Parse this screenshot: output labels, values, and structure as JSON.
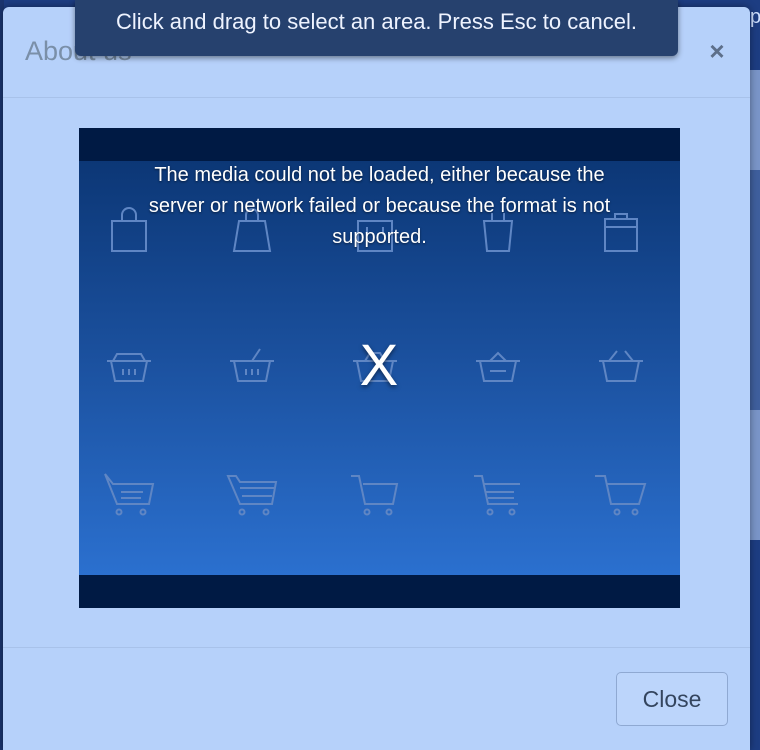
{
  "modal": {
    "title": "About us",
    "close_symbol": "×"
  },
  "capture_banner": {
    "text": "Click and drag to select an area. Press Esc to cancel."
  },
  "video": {
    "error_lines": [
      "The media could not be loaded, either because the",
      "server or network failed or because the format is not",
      "supported."
    ],
    "error_symbol": "X",
    "icons": [
      [
        "shopping-bag-icon",
        "shopping-bag-icon",
        "shopping-bag-icon",
        "shopping-bag-icon",
        "shopping-bag-icon"
      ],
      [
        "basket-icon",
        "basket-icon",
        "basket-icon",
        "basket-icon",
        "basket-icon"
      ],
      [
        "shopping-cart-icon",
        "shopping-cart-icon",
        "shopping-cart-icon",
        "shopping-cart-icon",
        "shopping-cart-icon"
      ]
    ]
  },
  "footer": {
    "close_label": "Close"
  },
  "colors": {
    "modal_bg": "#b6d1fa",
    "video_bg": "#001a44",
    "gradient_top": "#0c3776",
    "gradient_bottom": "#2b70cf",
    "banner_bg": "#26416e"
  }
}
